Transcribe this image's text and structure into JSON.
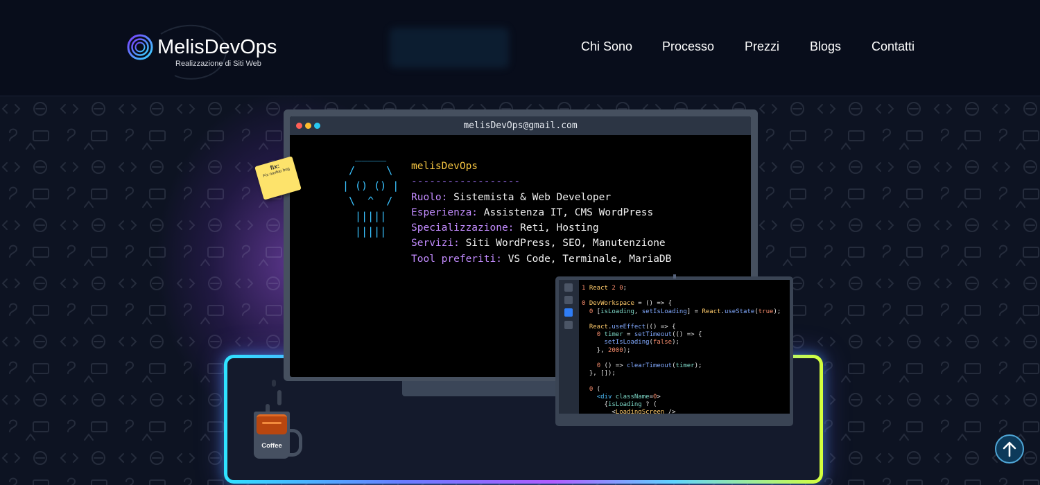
{
  "header": {
    "logo_title": "MelisDevOps",
    "logo_subtitle": "Realizzazione di Siti Web",
    "nav": [
      {
        "label": "Chi Sono"
      },
      {
        "label": "Processo"
      },
      {
        "label": "Prezzi"
      },
      {
        "label": "Blogs"
      },
      {
        "label": "Contatti"
      }
    ]
  },
  "hero": {
    "sticky_note": {
      "title": "fix:",
      "text": "Fix navbar bug"
    },
    "terminal": {
      "title": "melisDevOps@gmail.com",
      "ascii_art": "  _____\n /     \\\n| () () |\n \\  ^  /\n  |||||\n  |||||",
      "username": "melisDevOps",
      "separator": "------------------",
      "rows": [
        {
          "key": "Ruolo:",
          "value": "Sistemista & Web Developer"
        },
        {
          "key": "Esperienza:",
          "value": "Assistenza IT, CMS WordPress"
        },
        {
          "key": "Specializzazione:",
          "value": "Reti, Hosting"
        },
        {
          "key": "Servizi:",
          "value": "Siti WordPress, SEO, Manutenzione"
        },
        {
          "key": "Tool preferiti:",
          "value": "VS Code, Terminale, MariaDB"
        }
      ]
    },
    "code_lines": [
      "import React from 'react';",
      "",
      "const DevWorkspace = () => {",
      "  const [isLoading, setIsLoading] = React.useState(true);",
      "",
      "  React.useEffect(() => {",
      "    const timer = setTimeout(() => {",
      "      setIsLoading(false);",
      "    }, 2000);",
      "",
      "    return () => clearTimeout(timer);",
      "  }, []);",
      "",
      "  return (",
      "    <div className=\"workspace\">",
      "      {isLoading ? (",
      "        <LoadingScreen />"
    ],
    "mug_label": "Coffee"
  },
  "colors": {
    "background": "#0b1120",
    "navbar": "#080d1b",
    "accent_cyan": "#39c2ff",
    "accent_purple": "#c38cff",
    "accent_yellow": "#f5c542",
    "mat_glow_start": "#2fe3ff",
    "mat_glow_end": "#d4ff3c"
  },
  "icons": {
    "logo": "concentric-rings-icon",
    "back_to_top": "arrow-up-icon",
    "window_dots": [
      "close-dot",
      "minimize-dot",
      "maximize-dot"
    ]
  }
}
